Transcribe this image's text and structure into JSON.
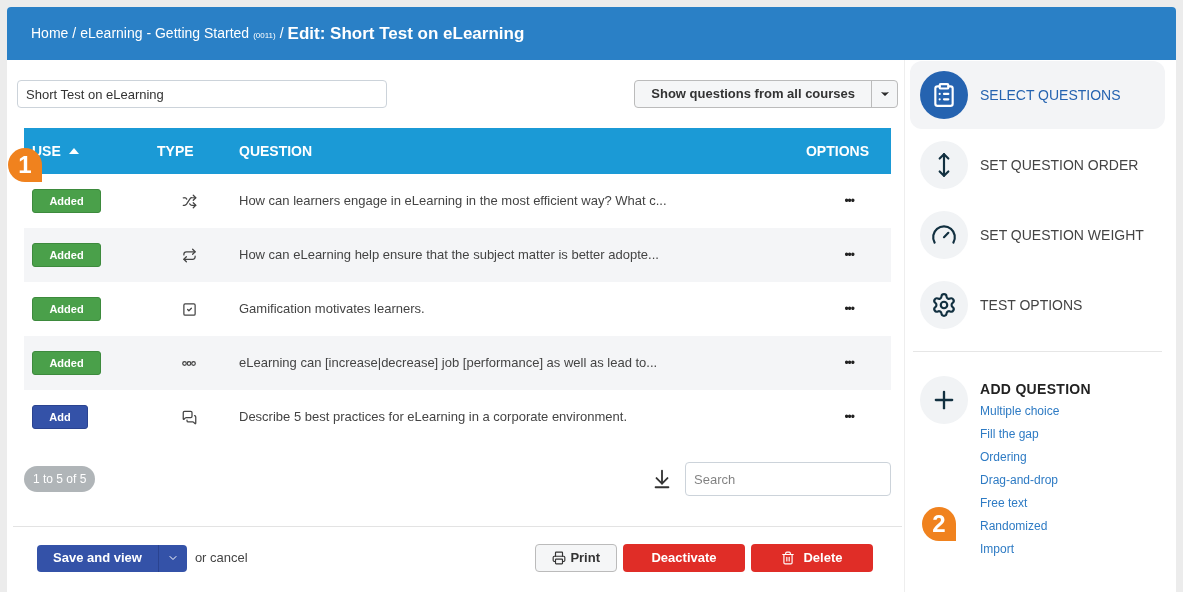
{
  "breadcrumb": {
    "items": [
      "Home",
      "eLearning - Getting Started"
    ],
    "code": "(0011)",
    "separator": "/",
    "current": "Edit: Short Test on eLearning"
  },
  "title_field": {
    "value": "Short Test on eLearning"
  },
  "filter_button": {
    "label": "Show questions from all courses"
  },
  "table": {
    "columns": [
      {
        "label": "USE",
        "sorted": true
      },
      {
        "label": "TYPE",
        "sorted": false
      },
      {
        "label": "QUESTION",
        "sorted": false
      },
      {
        "label": "OPTIONS",
        "sorted": false
      }
    ],
    "rows": [
      {
        "status": "Added",
        "kind": "added",
        "question": "How can learners engage in eLearning in the most efficient way? What c...",
        "options": "•••"
      },
      {
        "status": "Added",
        "kind": "added",
        "question": "How can eLearning help ensure that the subject matter is better adopte...",
        "options": "•••"
      },
      {
        "status": "Added",
        "kind": "added",
        "question": "Gamification motivates learners.",
        "options": "•••"
      },
      {
        "status": "Added",
        "kind": "added",
        "question": "eLearning can [increase|decrease] job [performance] as well as lead to...",
        "options": "•••"
      },
      {
        "status": "Add",
        "kind": "add",
        "question": "Describe 5 best practices for eLearning in a corporate environment.",
        "options": "•••"
      }
    ]
  },
  "pagination": "1 to 5 of 5",
  "search": {
    "placeholder": "Search"
  },
  "footer": {
    "save": "Save and view",
    "cancel": "or cancel",
    "print": "Print",
    "deactivate": "Deactivate",
    "delete": "Delete"
  },
  "steps": [
    {
      "label": "SELECT QUESTIONS",
      "selected": true
    },
    {
      "label": "SET QUESTION ORDER",
      "selected": false
    },
    {
      "label": "SET QUESTION WEIGHT",
      "selected": false
    },
    {
      "label": "TEST OPTIONS",
      "selected": false
    }
  ],
  "add_question": {
    "title": "ADD QUESTION",
    "links": [
      "Multiple choice",
      "Fill the gap",
      "Ordering",
      "Drag-and-drop",
      "Free text",
      "Randomized",
      "Import"
    ]
  },
  "callouts": [
    "1",
    "2"
  ]
}
